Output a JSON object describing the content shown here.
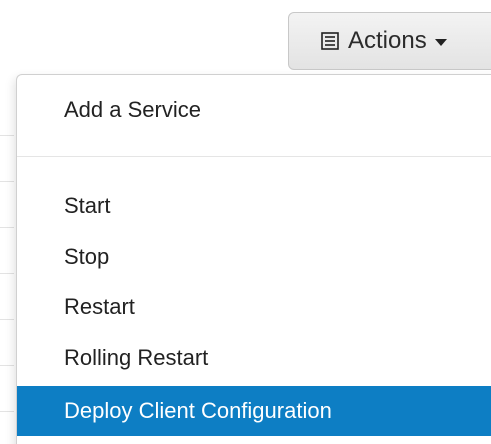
{
  "actions_button": {
    "label": "Actions",
    "icon": "list-icon"
  },
  "menu": {
    "items": [
      {
        "label": "Add a Service"
      },
      {
        "label": "Start"
      },
      {
        "label": "Stop"
      },
      {
        "label": "Restart"
      },
      {
        "label": "Rolling Restart"
      },
      {
        "label": "Deploy Client Configuration",
        "highlighted": true
      }
    ]
  },
  "colors": {
    "highlight_bg": "#0d7ec4",
    "highlight_text": "#ffffff"
  }
}
